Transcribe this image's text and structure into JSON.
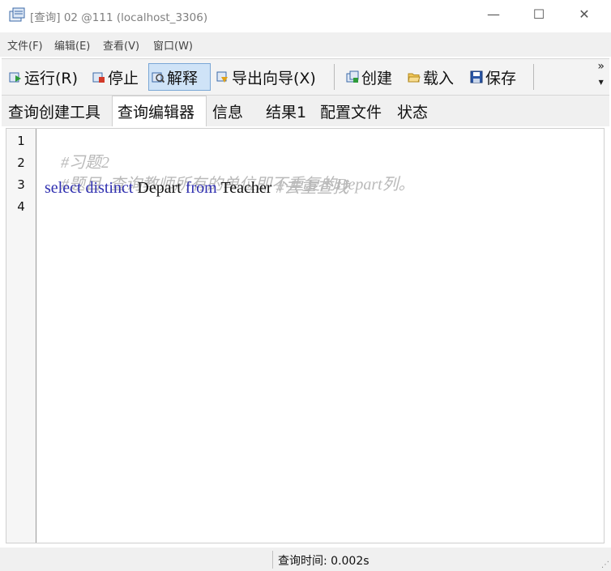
{
  "window": {
    "title": "[查询] 02 @111 (localhost_3306)",
    "controls": {
      "minimize": "—",
      "maximize": "☐",
      "close": "✕"
    }
  },
  "menu": {
    "items": [
      {
        "label": "文件(F)"
      },
      {
        "label": "编辑(E)"
      },
      {
        "label": "查看(V)"
      },
      {
        "label": "窗口(W)"
      }
    ]
  },
  "toolbar": {
    "run": {
      "label": "运行(R)",
      "icon": "run-icon"
    },
    "stop": {
      "label": "停止",
      "icon": "stop-icon"
    },
    "explain": {
      "label": "解释",
      "icon": "explain-icon",
      "pressed": true
    },
    "export": {
      "label": "导出向导(X)",
      "icon": "export-icon"
    },
    "create": {
      "label": "创建",
      "icon": "create-icon"
    },
    "load": {
      "label": "载入",
      "icon": "folder-icon"
    },
    "save": {
      "label": "保存",
      "icon": "save-icon"
    },
    "overflow": "»"
  },
  "tabs": [
    {
      "label": "查询创建工具",
      "active": false
    },
    {
      "label": "查询编辑器",
      "active": true
    },
    {
      "label": "信息",
      "active": false
    },
    {
      "label": "结果1",
      "active": false
    },
    {
      "label": "配置文件",
      "active": false
    },
    {
      "label": "状态",
      "active": false
    }
  ],
  "editor": {
    "line_numbers": [
      "1",
      "2",
      "3",
      "4"
    ],
    "lines": [
      {
        "comment": "#习题2"
      },
      {
        "comment": "#题目  查询教师所有的单位即不重复的Depart列。"
      },
      {
        "kw1": "select",
        "kw2": "distinct",
        "id1": "Depart",
        "kw3": "from",
        "id2": "Teacher",
        "comment": "#去重查找"
      },
      {}
    ]
  },
  "status": {
    "query_time": "查询时间: 0.002s"
  },
  "colors": {
    "keyword": "#2f2fb0",
    "comment": "#b9b9b9",
    "pressed_bg": "#cfe3f7"
  }
}
